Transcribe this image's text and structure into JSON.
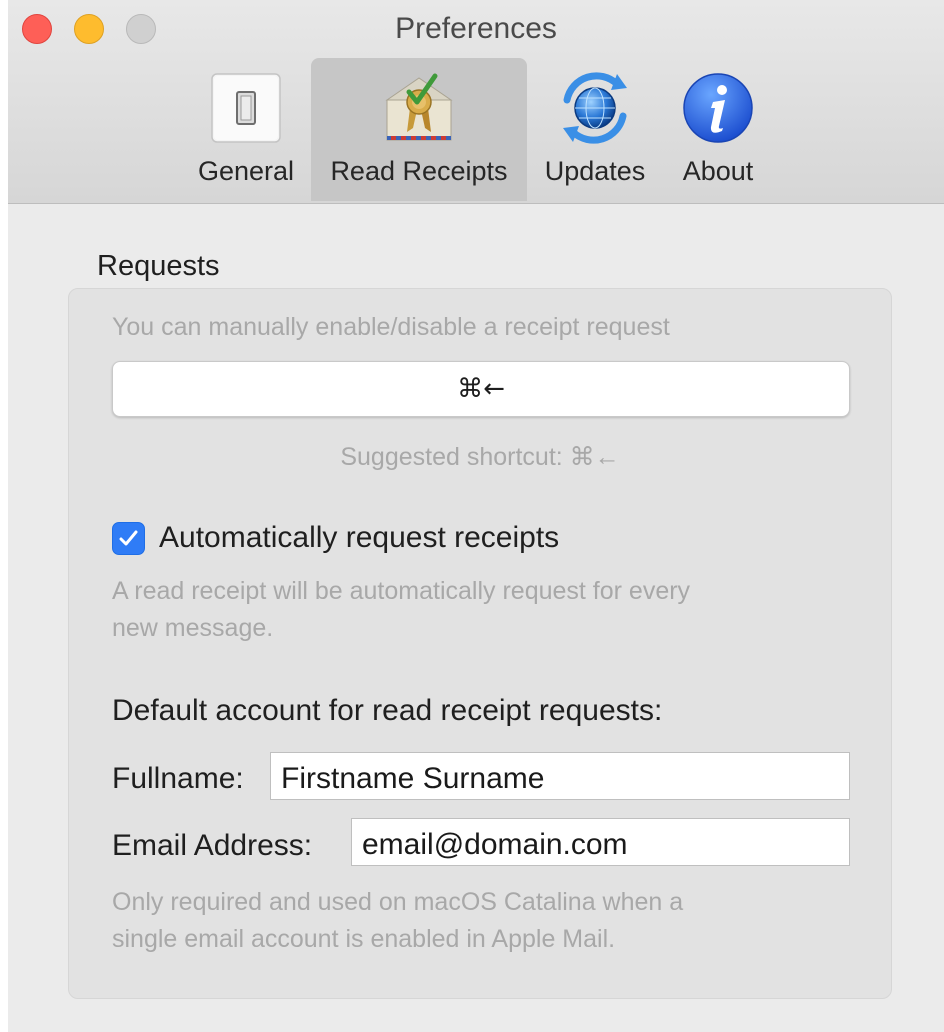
{
  "window": {
    "title": "Preferences"
  },
  "tabs": [
    {
      "label": "General",
      "icon": "toggle-switch-icon",
      "selected": false
    },
    {
      "label": "Read Receipts",
      "icon": "envelope-receipt-icon",
      "selected": true
    },
    {
      "label": "Updates",
      "icon": "globe-refresh-icon",
      "selected": false
    },
    {
      "label": "About",
      "icon": "info-icon",
      "selected": false
    }
  ],
  "requests": {
    "section_title": "Requests",
    "manual_hint": "You can manually enable/disable a receipt request",
    "shortcut_value": "⌘←",
    "suggested_shortcut": "Suggested shortcut: ⌘←",
    "auto_request_label": "Automatically request receipts",
    "auto_request_checked": true,
    "auto_request_hint_line1": "A read receipt will be automatically request for every",
    "auto_request_hint_line2": "new message.",
    "default_account_label": "Default account for read receipt requests:",
    "fullname_label": "Fullname:",
    "fullname_value": "Firstname Surname",
    "email_label": "Email Address:",
    "email_value": "email@domain.com",
    "footer_hint_line1": "Only required and used on macOS Catalina when a",
    "footer_hint_line2": "single email account is enabled in Apple Mail."
  },
  "colors": {
    "accent": "#2f7cf6",
    "close": "#fe5f57",
    "minimize": "#febc2e",
    "zoom_disabled": "#d0d0d0"
  }
}
